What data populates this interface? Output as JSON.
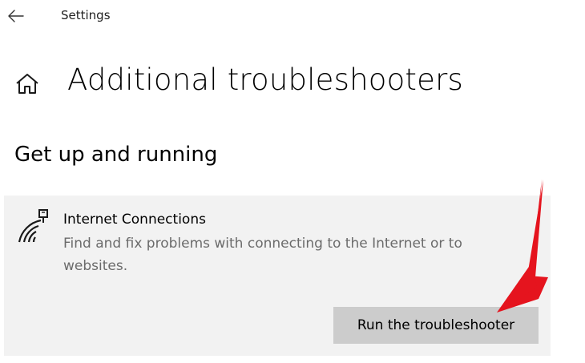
{
  "window": {
    "title": "Settings",
    "back_icon": "arrow-left-icon"
  },
  "header": {
    "icon": "home-icon",
    "title": "Additional troubleshooters"
  },
  "section": {
    "title": "Get up and running"
  },
  "troubleshooter": {
    "icon": "internet-connections-icon",
    "name": "Internet Connections",
    "description": "Find and fix problems with connecting to the Internet or to websites.",
    "run_label": "Run the troubleshooter"
  },
  "annotation": {
    "type": "pointer-arrow",
    "color": "#e5141e"
  },
  "colors": {
    "card_background": "#f2f2f2",
    "button_background": "#cccccc",
    "description_text": "#6b6b6b"
  }
}
